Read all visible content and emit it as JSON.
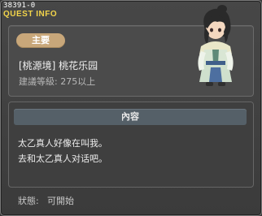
{
  "window": {
    "quest_id": "38391-0",
    "title": "QUEST INFO"
  },
  "header": {
    "tag_label": "主要",
    "quest_name": "[桃源境] 桃花乐园",
    "level_text": "建議等級: 275以上",
    "npc_icon": "npc-portrait-icon"
  },
  "content": {
    "header_label": "內容",
    "lines": [
      "太乙真人好像在叫我。",
      "去和太乙真人对话吧。"
    ]
  },
  "status": {
    "label": "狀態:",
    "value": "可開始"
  },
  "colors": {
    "title": "#f2d44a",
    "tag": "#c8a77a",
    "content_header": "#556068"
  }
}
